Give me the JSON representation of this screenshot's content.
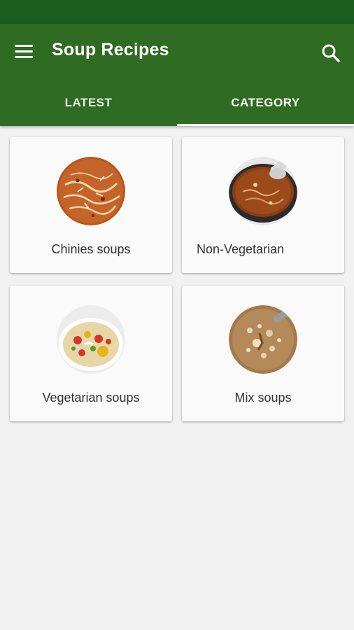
{
  "app_bar": {
    "title": "Soup Recipes",
    "menu_icon": "hamburger-menu-icon",
    "search_icon": "search-icon"
  },
  "tabs": [
    {
      "label": "LATEST",
      "selected": false
    },
    {
      "label": "CATEGORY",
      "selected": true
    }
  ],
  "categories": [
    {
      "label": "Chinies soups",
      "image": "hot-sour-soup-image"
    },
    {
      "label": "Non-Vegetarian",
      "image": "brown-soup-bowl-image"
    },
    {
      "label": "Vegetarian soups",
      "image": "vegetable-soup-image"
    },
    {
      "label": "Mix  soups",
      "image": "mixed-soup-image"
    }
  ],
  "colors": {
    "status_bar": "#1b5d1f",
    "app_bar": "#2f6b22",
    "background": "#f1f1f1",
    "card": "#fafafa"
  }
}
